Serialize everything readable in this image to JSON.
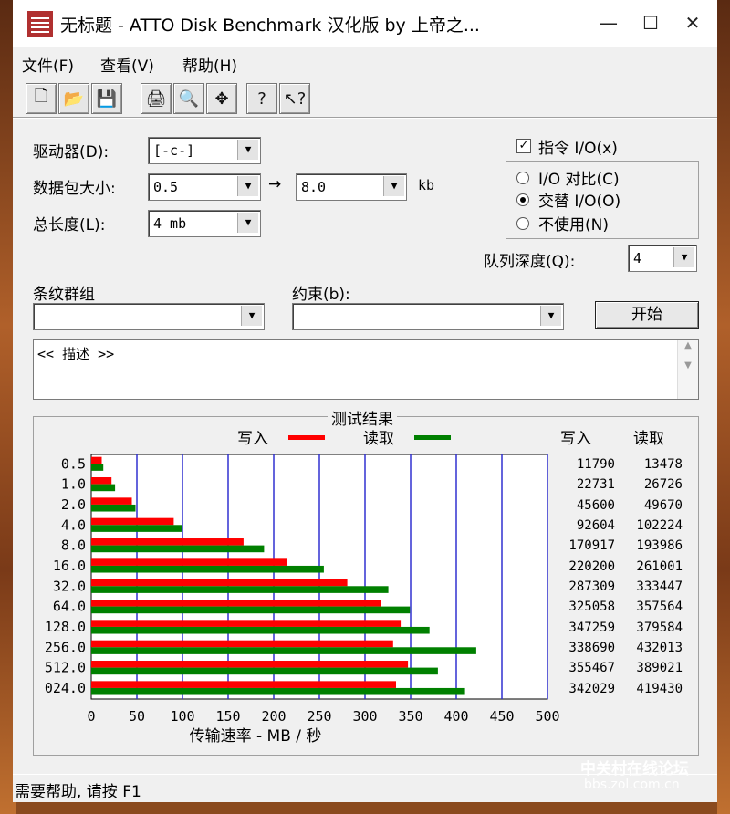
{
  "window": {
    "title": "无标题 - ATTO Disk Benchmark 汉化版 by 上帝之...",
    "minimize_glyph": "—",
    "maximize_glyph": "☐",
    "close_glyph": "✕"
  },
  "menu": [
    {
      "label": "文件(F)"
    },
    {
      "label": "查看(V)"
    },
    {
      "label": "帮助(H)"
    }
  ],
  "toolbar": [
    {
      "icon": "new-file-icon",
      "glyph": "🗋"
    },
    {
      "icon": "open-folder-icon",
      "glyph": "📂"
    },
    {
      "icon": "save-icon",
      "glyph": "💾"
    },
    {
      "icon": "print-icon",
      "glyph": "🖨"
    },
    {
      "icon": "print-preview-icon",
      "glyph": "🔍"
    },
    {
      "icon": "move-icon",
      "glyph": "✥"
    },
    {
      "icon": "about-icon",
      "glyph": "?"
    },
    {
      "icon": "context-help-icon",
      "glyph": "↖?"
    }
  ],
  "form": {
    "drive_label": "驱动器(D):",
    "drive_value": "[-c-]",
    "packet_label": "数据包大小:",
    "packet_from": "0.5",
    "packet_to": "8.0",
    "packet_unit": "kb",
    "arrow": "→",
    "length_label": "总长度(L):",
    "length_value": "4 mb",
    "stripe_label": "条纹群组",
    "stripe_value": "",
    "constraint_label": "约束(b):",
    "constraint_value": "",
    "description": "<< 描述 >>"
  },
  "options": {
    "direct_io_label": "指令 I/O(x)",
    "direct_io_checked": "✓",
    "io_compare_label": "I/O 对比(C)",
    "overlap_io_label": "交替 I/O(O)",
    "neither_label": "不使用(N)",
    "selected": "overlap_io",
    "queue_label": "队列深度(Q):",
    "queue_value": "4",
    "start_label": "开始"
  },
  "results": {
    "title": "测试结果",
    "write_legend": "写入",
    "read_legend": "读取",
    "write_col": "写入",
    "read_col": "读取",
    "write_color": "#ff0000",
    "read_color": "#008000",
    "xlabel": "传输速率 - MB / 秒",
    "write_values_text": [
      "11790",
      "22731",
      "45600",
      "92604",
      "170917",
      "220200",
      "287309",
      "325058",
      "347259",
      "338690",
      "355467",
      "342029"
    ],
    "read_values_text": [
      "13478",
      "26726",
      "49670",
      "102224",
      "193986",
      "261001",
      "333447",
      "357564",
      "379584",
      "432013",
      "389021",
      "419430"
    ]
  },
  "chart_data": {
    "type": "bar",
    "orientation": "horizontal",
    "categories": [
      "0.5",
      "1.0",
      "2.0",
      "4.0",
      "8.0",
      "16.0",
      "32.0",
      "64.0",
      "128.0",
      "256.0",
      "512.0",
      "024.0"
    ],
    "series": [
      {
        "name": "写入",
        "color": "#ff0000",
        "values": [
          11.5,
          22.2,
          44.5,
          90.4,
          166.9,
          215.0,
          280.6,
          317.4,
          339.1,
          330.8,
          347.1,
          334.0
        ]
      },
      {
        "name": "读取",
        "color": "#008000",
        "values": [
          13.2,
          26.1,
          48.5,
          99.8,
          189.4,
          254.9,
          325.6,
          349.2,
          370.7,
          421.9,
          379.9,
          409.6
        ]
      }
    ],
    "xlabel": "传输速率 - MB / 秒",
    "xlim": [
      0,
      500
    ],
    "xticks": [
      "0",
      "50",
      "100",
      "150",
      "200",
      "250",
      "300",
      "350",
      "400",
      "450",
      "500"
    ],
    "grid": "vertical",
    "legend": "top"
  },
  "status": {
    "text": "需要帮助, 请按 F1"
  },
  "watermark": {
    "line1": "中关村在线论坛",
    "line2": "bbs.zol.com.cn"
  }
}
